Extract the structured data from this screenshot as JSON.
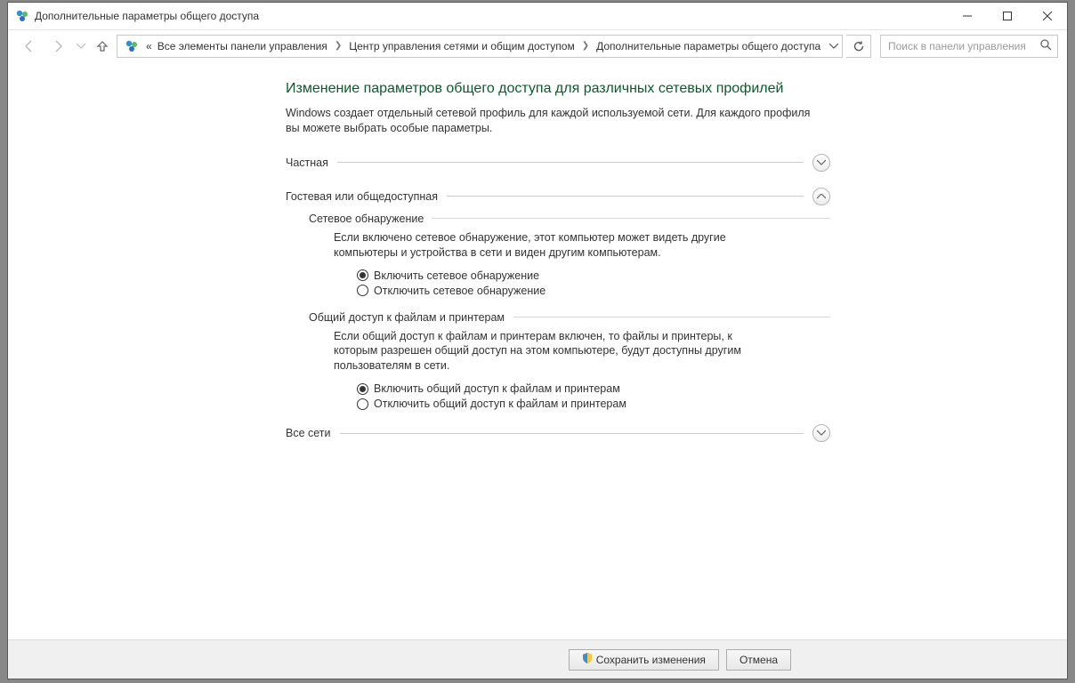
{
  "window_title": "Дополнительные параметры общего доступа",
  "breadcrumb": {
    "prefix": "«",
    "items": [
      "Все элементы панели управления",
      "Центр управления сетями и общим доступом",
      "Дополнительные параметры общего доступа"
    ]
  },
  "search": {
    "placeholder": "Поиск в панели управления"
  },
  "page": {
    "title": "Изменение параметров общего доступа для различных сетевых профилей",
    "description": "Windows создает отдельный сетевой профиль для каждой используемой сети. Для каждого профиля вы можете выбрать особые параметры."
  },
  "sections": {
    "private": {
      "label": "Частная",
      "expanded": false
    },
    "guest_public": {
      "label": "Гостевая или общедоступная",
      "expanded": true,
      "network_discovery": {
        "heading": "Сетевое обнаружение",
        "explain": "Если включено сетевое обнаружение, этот компьютер может видеть другие компьютеры и устройства в сети и виден другим компьютерам.",
        "option_on": "Включить сетевое обнаружение",
        "option_off": "Отключить сетевое обнаружение",
        "selected": "on"
      },
      "file_printer": {
        "heading": "Общий доступ к файлам и принтерам",
        "explain": "Если общий доступ к файлам и принтерам включен, то файлы и принтеры, к которым разрешен общий доступ на этом компьютере, будут доступны другим пользователям в сети.",
        "option_on": "Включить общий доступ к файлам и принтерам",
        "option_off": "Отключить общий доступ к файлам и принтерам",
        "selected": "on"
      }
    },
    "all_networks": {
      "label": "Все сети",
      "expanded": false
    }
  },
  "footer": {
    "save": "Сохранить изменения",
    "cancel": "Отмена"
  }
}
